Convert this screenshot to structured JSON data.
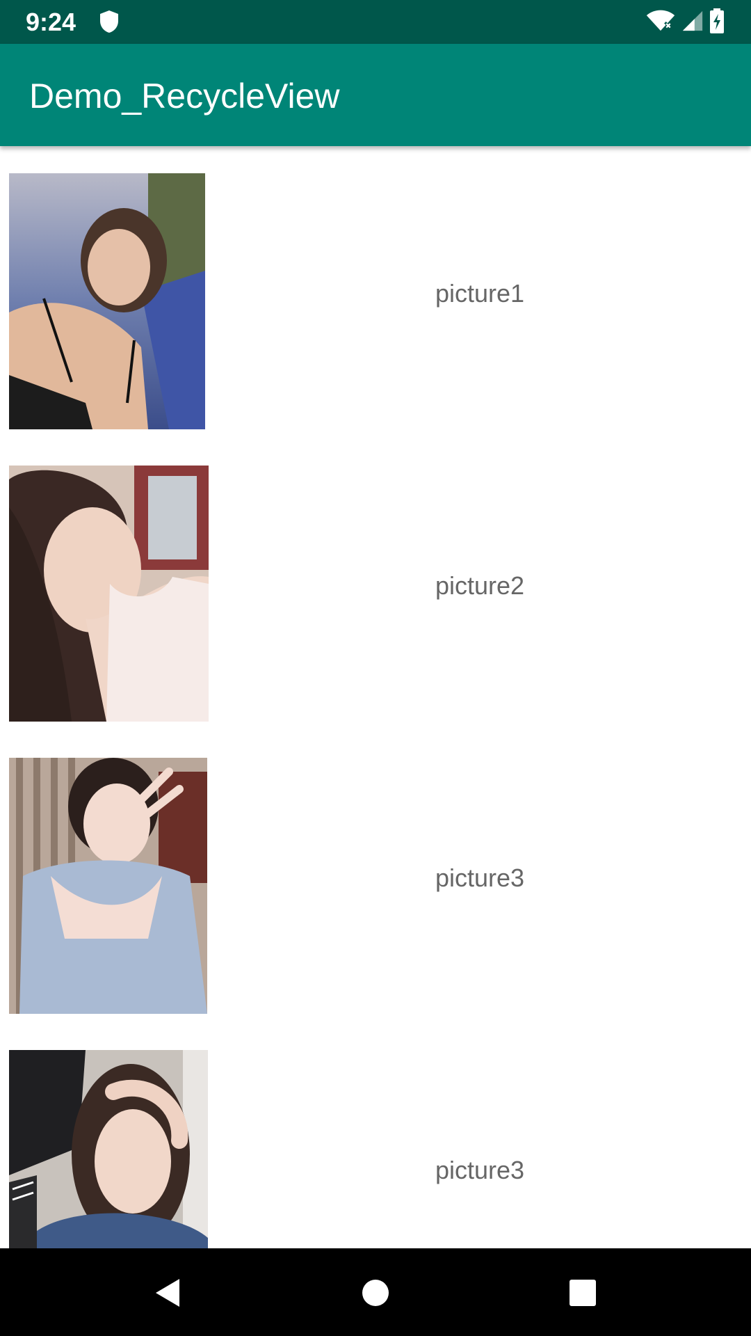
{
  "status_bar": {
    "time": "9:24",
    "icons": [
      "shield-icon",
      "wifi-icon",
      "signal-icon",
      "battery-icon"
    ]
  },
  "app_bar": {
    "title": "Demo_RecycleView",
    "color": "#008577",
    "status_color": "#00574b"
  },
  "list": {
    "items": [
      {
        "label": "picture1",
        "image": "photo-woman-pool"
      },
      {
        "label": "picture2",
        "image": "photo-woman-white-top"
      },
      {
        "label": "picture3",
        "image": "photo-woman-blue-sweater"
      },
      {
        "label": "picture3",
        "image": "photo-woman-denim-jacket"
      }
    ]
  },
  "nav_bar": {
    "buttons": [
      "back-icon",
      "home-icon",
      "recents-icon"
    ]
  }
}
